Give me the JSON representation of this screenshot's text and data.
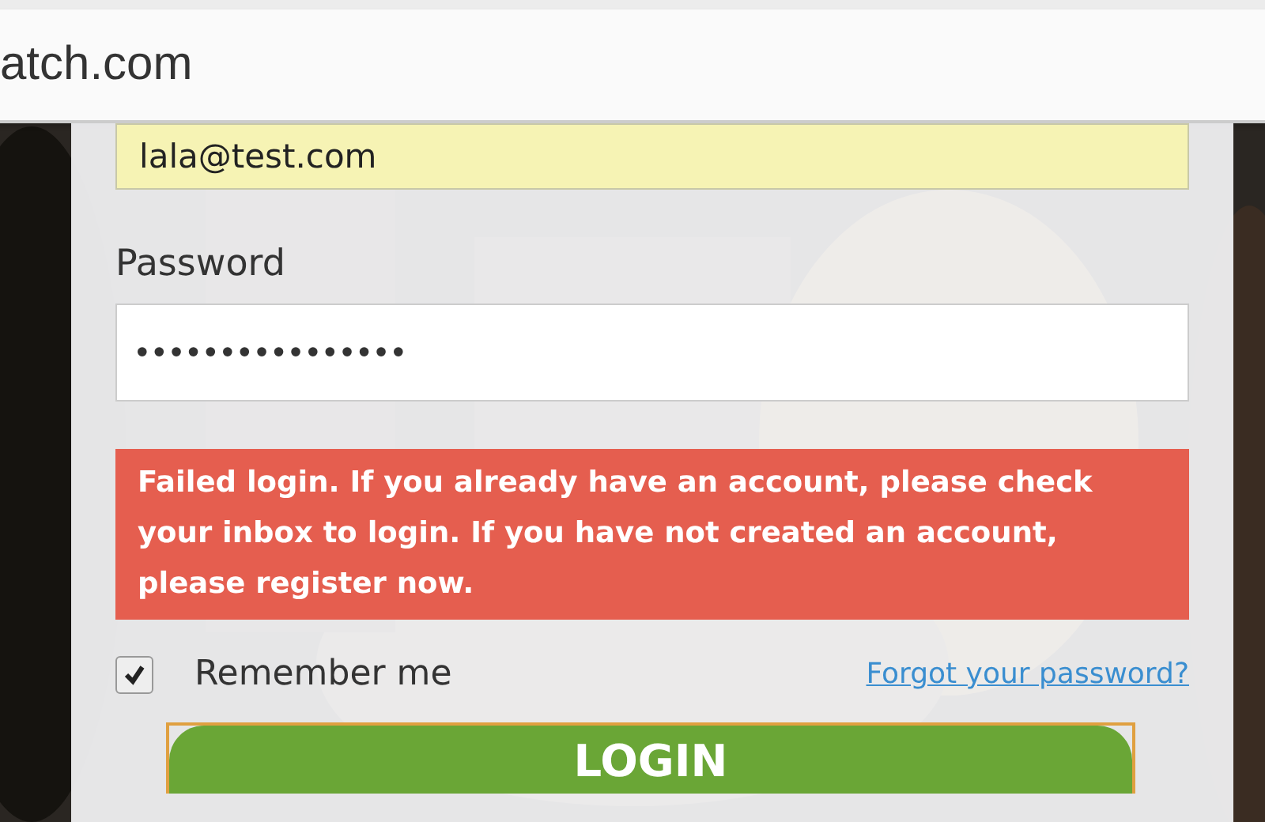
{
  "address_bar": {
    "url": "atch.com"
  },
  "login_form": {
    "email": {
      "value": "lala@test.com"
    },
    "password": {
      "label": "Password",
      "value": "••••••••••••••••"
    },
    "error": "Failed login. If you already have an account, please check your inbox to login. If you have not created an account, please register now.",
    "remember_me": {
      "label": "Remember me",
      "checked": true
    },
    "forgot_link": "Forgot your password?",
    "login_button": "LOGIN"
  }
}
